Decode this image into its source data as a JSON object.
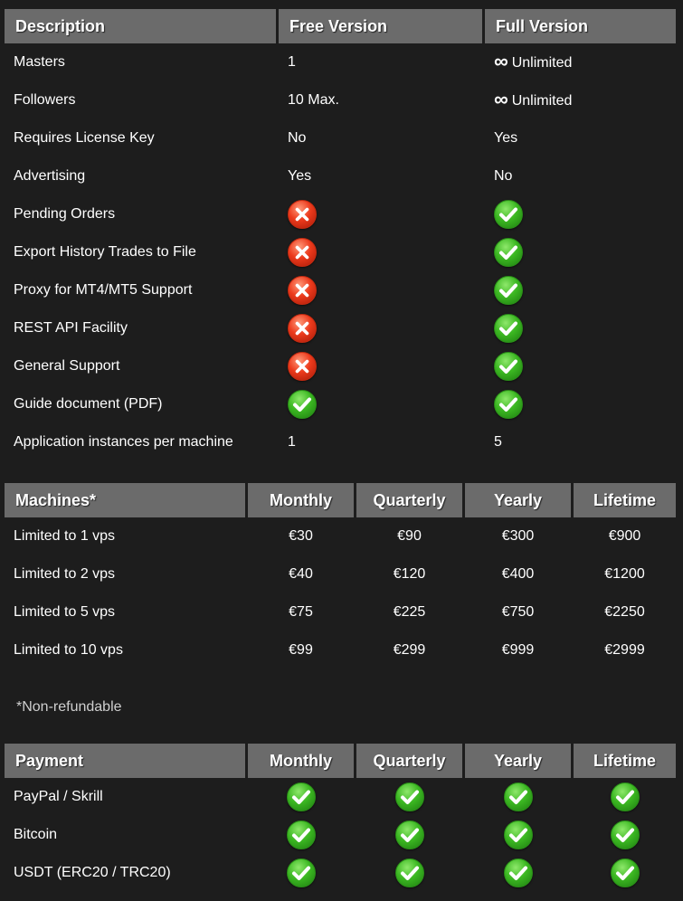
{
  "features": {
    "headers": [
      "Description",
      "Free Version",
      "Full Version"
    ],
    "rows": [
      {
        "label": "Masters",
        "free": {
          "type": "text",
          "text": "1"
        },
        "full": {
          "type": "unlimited",
          "text": "Unlimited"
        }
      },
      {
        "label": "Followers",
        "free": {
          "type": "text",
          "text": "10 Max."
        },
        "full": {
          "type": "unlimited",
          "text": "Unlimited"
        }
      },
      {
        "label": "Requires License Key",
        "free": {
          "type": "text",
          "text": "No"
        },
        "full": {
          "type": "text",
          "text": "Yes"
        }
      },
      {
        "label": "Advertising",
        "free": {
          "type": "text",
          "text": "Yes"
        },
        "full": {
          "type": "text",
          "text": "No"
        }
      },
      {
        "label": "Pending Orders",
        "free": {
          "type": "no"
        },
        "full": {
          "type": "yes"
        }
      },
      {
        "label": "Export History Trades to File",
        "free": {
          "type": "no"
        },
        "full": {
          "type": "yes"
        }
      },
      {
        "label": "Proxy for MT4/MT5 Support",
        "free": {
          "type": "no"
        },
        "full": {
          "type": "yes"
        }
      },
      {
        "label": "REST API Facility",
        "free": {
          "type": "no"
        },
        "full": {
          "type": "yes"
        }
      },
      {
        "label": "General Support",
        "free": {
          "type": "no"
        },
        "full": {
          "type": "yes"
        }
      },
      {
        "label": "Guide document (PDF)",
        "free": {
          "type": "yes"
        },
        "full": {
          "type": "yes"
        }
      },
      {
        "label": "Application instances per machine",
        "free": {
          "type": "text",
          "text": "1"
        },
        "full": {
          "type": "text",
          "text": "5"
        }
      }
    ]
  },
  "machines": {
    "headers": [
      "Machines*",
      "Monthly",
      "Quarterly",
      "Yearly",
      "Lifetime"
    ],
    "rows": [
      {
        "label": "Limited to 1 vps",
        "values": [
          "€30",
          "€90",
          "€300",
          "€900"
        ]
      },
      {
        "label": "Limited to 2 vps",
        "values": [
          "€40",
          "€120",
          "€400",
          "€1200"
        ]
      },
      {
        "label": "Limited to 5 vps",
        "values": [
          "€75",
          "€225",
          "€750",
          "€2250"
        ]
      },
      {
        "label": "Limited to 10 vps",
        "values": [
          "€99",
          "€299",
          "€999",
          "€2999"
        ]
      }
    ],
    "note": "*Non-refundable"
  },
  "payment": {
    "headers": [
      "Payment",
      "Monthly",
      "Quarterly",
      "Yearly",
      "Lifetime"
    ],
    "rows": [
      {
        "label": "PayPal / Skrill",
        "values": [
          "yes",
          "yes",
          "yes",
          "yes"
        ]
      },
      {
        "label": "Bitcoin",
        "values": [
          "yes",
          "yes",
          "yes",
          "yes"
        ]
      },
      {
        "label": "USDT (ERC20 / TRC20)",
        "values": [
          "yes",
          "yes",
          "yes",
          "yes"
        ]
      }
    ]
  },
  "icons": {
    "unlimited": "infinity-icon",
    "yes": "check-circle-icon",
    "no": "cross-circle-icon"
  },
  "colors": {
    "background": "#1d1d1d",
    "header": "#6b6b6b",
    "yes": "#3cb822",
    "no": "#ec3a1c"
  }
}
